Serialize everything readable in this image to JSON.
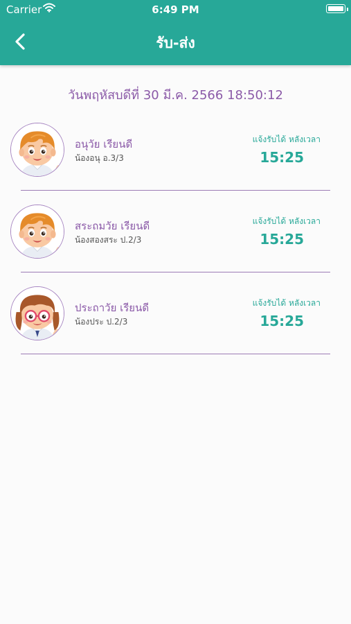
{
  "status_bar": {
    "carrier": "Carrier",
    "time": "6:49 PM"
  },
  "header": {
    "title": "รับ-ส่ง",
    "back_icon": "chevron-left-icon"
  },
  "datetime": "วันพฤหัสบดีที่ 30 มี.ค. 2566 18:50:12",
  "colors": {
    "primary": "#27a898",
    "accent": "#8b5aa8",
    "divider": "#9c7bb5"
  },
  "students": [
    {
      "name": "อนุวัย เรียนดี",
      "nickname": "น้องอนุ อ.3/3",
      "note": "แจ้งรับได้ หลังเวลา",
      "time": "15:25",
      "avatar": "boy-avatar"
    },
    {
      "name": "สระถมวัย เรียนดี",
      "nickname": "น้องสองสระ ป.2/3",
      "note": "แจ้งรับได้ หลังเวลา",
      "time": "15:25",
      "avatar": "boy-avatar"
    },
    {
      "name": "ประถาวัย เรียนดี",
      "nickname": "น้องประ ป.2/3",
      "note": "แจ้งรับได้ หลังเวลา",
      "time": "15:25",
      "avatar": "girl-avatar"
    }
  ]
}
